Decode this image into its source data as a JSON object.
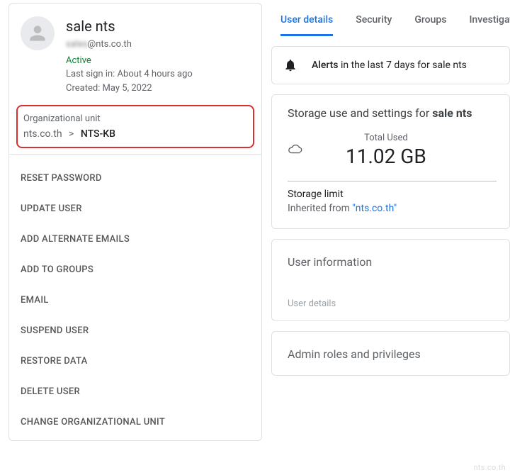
{
  "user": {
    "name": "sale nts",
    "email_prefix": "sales",
    "email_domain": "@nts.co.th",
    "status": "Active",
    "last_signin": "Last sign in: About 4 hours ago",
    "created": "Created: May 5, 2022"
  },
  "org": {
    "label": "Organizational unit",
    "root": "nts.co.th",
    "separator": ">",
    "current": "NTS-KB"
  },
  "actions": [
    "RESET PASSWORD",
    "UPDATE USER",
    "ADD ALTERNATE EMAILS",
    "ADD TO GROUPS",
    "EMAIL",
    "SUSPEND USER",
    "RESTORE DATA",
    "DELETE USER",
    "CHANGE ORGANIZATIONAL UNIT"
  ],
  "tabs": {
    "items": [
      "User details",
      "Security",
      "Groups",
      "Investigate"
    ],
    "active": 0
  },
  "alerts": {
    "bold": "Alerts",
    "rest": " in the last 7 days for sale nts"
  },
  "storage": {
    "title_prefix": "Storage use and settings for ",
    "title_bold": "sale nts",
    "total_label": "Total Used",
    "total_value": "11.02 GB",
    "limit_label": "Storage limit",
    "inherit_prefix": "Inherited from ",
    "inherit_link": "\"nts.co.th\""
  },
  "sections": {
    "userinfo_title": "User information",
    "userinfo_sub": "User details",
    "adminroles_title": "Admin roles and privileges"
  },
  "watermark": "nts.co.th"
}
